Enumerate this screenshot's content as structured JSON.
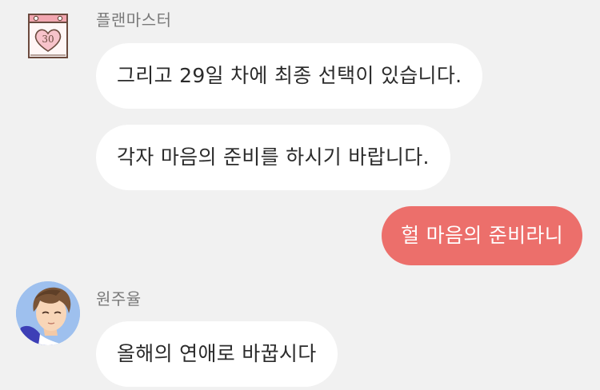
{
  "messages": [
    {
      "sender": "플랜마스터",
      "avatar_icon": "calendar-heart-icon",
      "calendar_number": "30",
      "bubbles": [
        "그리고 29일 차에 최종 선택이 있습니다.",
        "각자 마음의 준비를 하시기 바랍니다."
      ]
    },
    {
      "sender": "me",
      "bubbles": [
        "헐 마음의 준비라니"
      ]
    },
    {
      "sender": "원주율",
      "avatar_icon": "user-portrait-icon",
      "bubbles": [
        "올해의 연애로 바꿉시다"
      ]
    }
  ],
  "colors": {
    "background": "#f1f1f1",
    "incoming_bubble": "#ffffff",
    "outgoing_bubble": "#ec6f6b",
    "sender_name": "#7a7a7a",
    "calendar_pink": "#f2a6b0"
  }
}
